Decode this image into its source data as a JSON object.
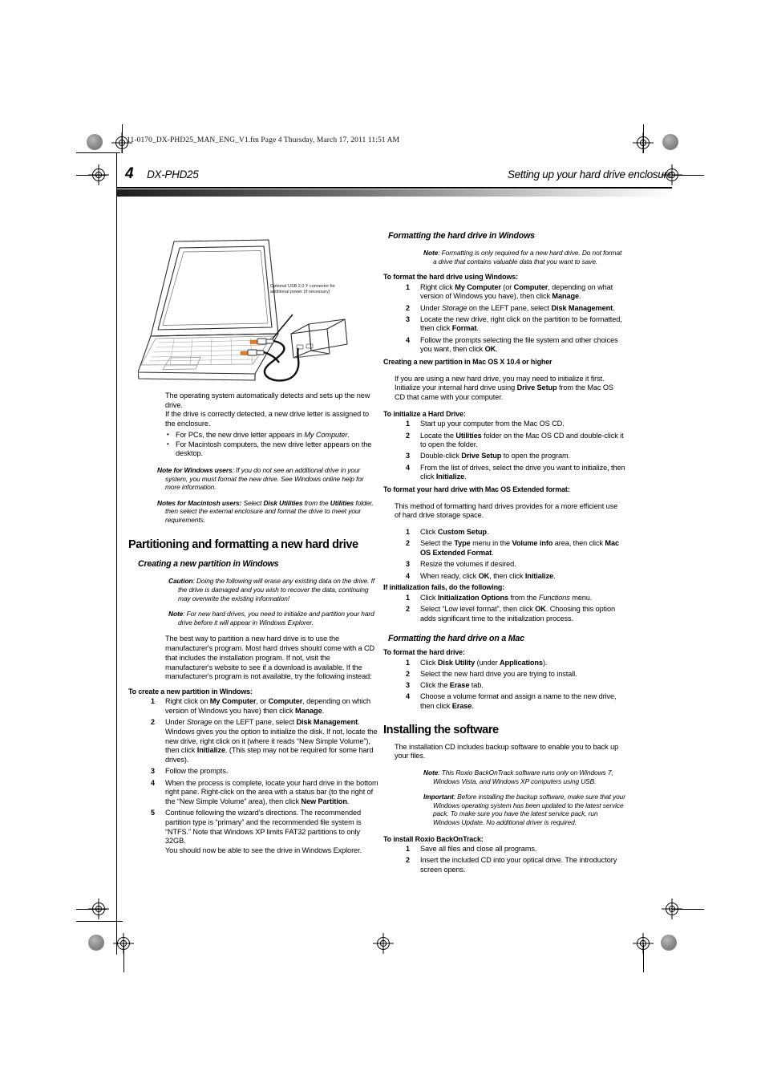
{
  "document": {
    "file_line": "11-0170_DX-PHD25_MAN_ENG_V1.fm  Page 4  Thursday, March 17, 2011  11:51 AM",
    "page_number": "4",
    "header_left": "DX-PHD25",
    "header_right": "Setting up your hard drive enclosure"
  },
  "figure": {
    "caption": "Optional USB 2.0 Y connector for additional power (if necessary)",
    "alt": "Laptop computer connected to a portable hard drive enclosure with a USB Y-cable"
  },
  "left_column": {
    "intro_p1": "The operating system automatically detects and sets up the new drive.",
    "intro_p2": "If the drive is correctly detected, a new drive letter is assigned to the enclosure.",
    "bullets": [
      "For PCs, the new drive letter appears in My Computer.",
      "For Macintosh computers, the new drive letter appears on the desktop."
    ],
    "note_windows_label": "Note for Windows users",
    "note_windows_text": ": If you do not see an additional drive in your system, you must format the new drive. See Windows online help for more information.",
    "note_mac_label": "Notes for Macintosh users:",
    "note_mac_text": " Select Disk Utilities from the Utilities folder, then select the external enclosure and format the drive to meet your requirements.",
    "section_title": "Partitioning and formatting a new hard drive",
    "subsection_title": "Creating a new partition in Windows",
    "caution_label": "Caution",
    "caution_text": ": Doing the following will erase any existing data on the drive. If the drive is damaged and you wish to recover the data, continuing may overwrite the existing information!",
    "note_label": "Note",
    "note_text": ": For new hard drives, you need to initialize and partition your hard drive before it will appear in Windows Explorer.",
    "best_way_p": "The best way to partition a new hard drive is to use the manufacturer's program. Most hard drives should come with a CD that includes the installation program. If not, visit the manufacturer's website to see if a download is available. If the manufacturer's program is not available, try the following instead:",
    "proc_heading": "To create a new partition in Windows:",
    "steps": [
      {
        "n": "1",
        "text": "Right click on My Computer, or Computer, depending on which version of Windows you have) then click Manage."
      },
      {
        "n": "2",
        "text": "Under Storage on the LEFT pane, select Disk Management. Windows gives you the option to initialize the disk. If not, locate the new drive, right click on it (where it reads \"New Simple Volume\"), then click Initialize. (This step may not be required for some hard drives)."
      },
      {
        "n": "3",
        "text": "Follow the prompts."
      },
      {
        "n": "4",
        "text": "When the process is complete, locate your hard drive in the bottom right pane. Right-click on the area with a status bar (to the right of the \"New Simple Volume\" area), then click New Partition."
      },
      {
        "n": "5",
        "text": "Continue following the wizard's directions. The recommended partition type is \"primary\" and the recommended file system is \"NTFS.\" Note that Windows XP limits FAT32 partitions to only 32GB."
      }
    ],
    "closing_line": "You should now be able to see the drive in Windows Explorer."
  },
  "right_column": {
    "fmt_windows_title": "Formatting the hard drive in Windows",
    "fmt_windows_note_label": "Note",
    "fmt_windows_note_text": ": Formatting is only required for a new hard drive. Do not format a drive that contains valuable data that you want to save.",
    "fmt_windows_proc_heading": "To format the hard drive using Windows:",
    "fmt_windows_steps": [
      {
        "n": "1",
        "text": "Right click My Computer (or Computer, depending on what version of Windows you have), then click Manage."
      },
      {
        "n": "2",
        "text": "Under Storage on the LEFT pane, select Disk Management."
      },
      {
        "n": "3",
        "text": "Locate the new drive, right click on the partition to be formatted, then click Format."
      },
      {
        "n": "4",
        "text": "Follow the prompts selecting the file system and other choices you want, then click OK."
      }
    ],
    "mac_partition_heading": "Creating a new partition in Mac OS X 10.4 or higher",
    "mac_partition_body": "If you are using a new hard drive, you may need to initialize it first. Initialize your internal hard drive using Drive Setup from the Mac OS CD that came with your computer.",
    "mac_init_proc_heading": "To initialize a Hard Drive:",
    "mac_init_steps": [
      {
        "n": "1",
        "text": "Start up your computer from the Mac OS CD."
      },
      {
        "n": "2",
        "text": "Locate the Utilities folder on the Mac OS CD and double-click it to open the folder."
      },
      {
        "n": "3",
        "text": "Double-click Drive Setup to open the program."
      },
      {
        "n": "4",
        "text": "From the list of drives, select the drive you want to initialize, then click Initialize."
      }
    ],
    "mac_ext_proc_heading": "To format your hard drive with Mac OS Extended format:",
    "mac_ext_body": "This method of formatting hard drives provides for a more efficient use of hard drive storage space.",
    "mac_ext_steps": [
      {
        "n": "1",
        "text": "Click Custom Setup."
      },
      {
        "n": "2",
        "text": "Select the Type menu in the Volume info area, then click Mac OS Extended Format."
      },
      {
        "n": "3",
        "text": "Resize the volumes if desired."
      },
      {
        "n": "4",
        "text": "When ready, click OK, then click Initialize."
      }
    ],
    "init_fails_heading": "If initialization fails, do the following:",
    "init_fails_steps": [
      {
        "n": "1",
        "text": "Click Initialization Options from the Functions menu."
      },
      {
        "n": "2",
        "text": "Select \"Low level format\", then click OK. Choosing this option adds significant time to the initialization process."
      }
    ],
    "fmt_mac_title": "Formatting the hard drive on a Mac",
    "fmt_mac_proc_heading": "To format the hard drive:",
    "fmt_mac_steps": [
      {
        "n": "1",
        "text": "Click Disk Utility (under Applications)."
      },
      {
        "n": "2",
        "text": "Select the new hard drive you are trying to install."
      },
      {
        "n": "3",
        "text": "Click the Erase tab."
      },
      {
        "n": "4",
        "text": "Choose a volume format and assign a name to the new drive, then click Erase."
      }
    ],
    "install_title": "Installing the software",
    "install_body": "The installation CD includes backup software to enable you to back up your files.",
    "install_note_label": "Note",
    "install_note_text": ": This Roxio BackOnTrack software runs only on Windows 7, Windows Vista, and Windows XP computers using USB.",
    "install_important_label": "Important",
    "install_important_text": ": Before installing the backup software, make sure that your Windows operating system has been updated to the latest service pack. To make sure you have the latest service pack, run Windows Update. No additional driver is required.",
    "install_proc_heading": "To install Roxio BackOnTrack:",
    "install_steps": [
      {
        "n": "1",
        "text": "Save all files and close all programs."
      },
      {
        "n": "2",
        "text": "Insert the included CD into your optical drive. The introductory screen opens."
      }
    ]
  }
}
